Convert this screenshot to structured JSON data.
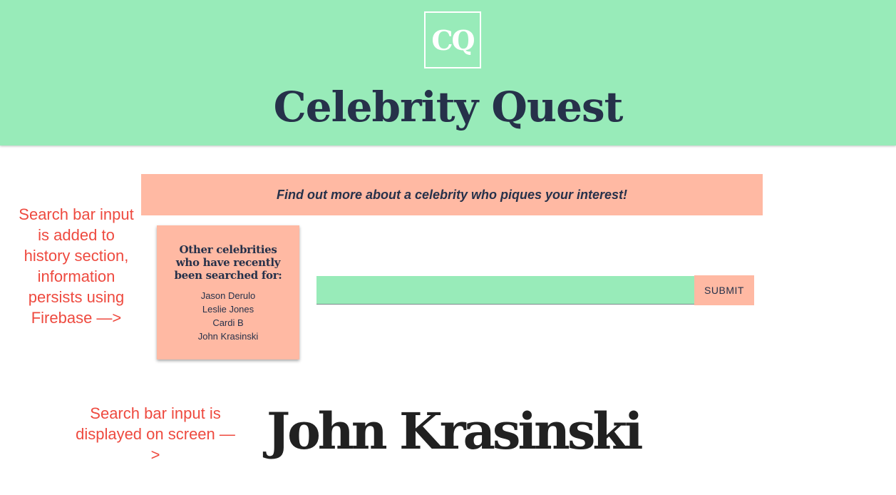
{
  "header": {
    "logo_text": "CQ",
    "title": "Celebrity Quest"
  },
  "tagline": "Find out more about a celebrity who piques your interest!",
  "history": {
    "heading": "Other celebrities who have recently been searched for:",
    "items": [
      "Jason Derulo",
      "Leslie Jones",
      "Cardi B",
      "John Krasinski"
    ]
  },
  "search": {
    "value": "",
    "placeholder": "",
    "submit_label": "SUBMIT"
  },
  "result": {
    "name": "John Krasinski"
  },
  "annotations": {
    "history_note": "Search bar input is added to history section, information persists using Firebase —>",
    "display_note": "Search bar input is displayed on screen —>"
  },
  "colors": {
    "header_bg": "#98ebb9",
    "accent_salmon": "#ffb9a3",
    "title_navy": "#26314a",
    "annotation_red": "#ee4a3f"
  }
}
